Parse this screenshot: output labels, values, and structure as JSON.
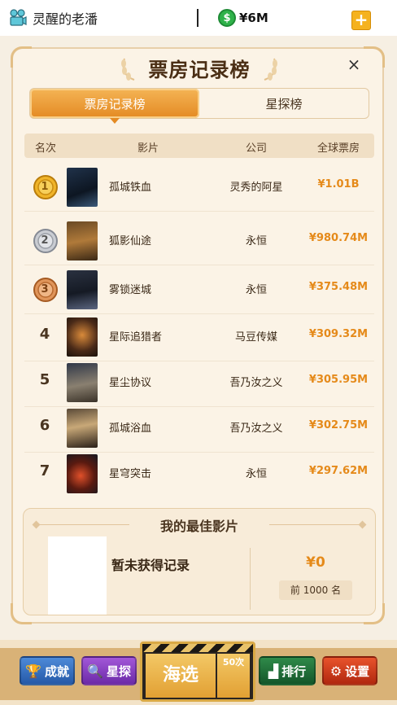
{
  "topbar": {
    "studio_name": "灵醒的老潘",
    "money": "¥6M",
    "coin_symbol": "$",
    "plus_label": "+"
  },
  "panel": {
    "title": "票房记录榜",
    "close_label": "×",
    "tabs": [
      {
        "label": "票房记录榜",
        "active": true
      },
      {
        "label": "星探榜",
        "active": false
      }
    ],
    "columns": [
      "名次",
      "影片",
      "公司",
      "全球票房"
    ],
    "rows": [
      {
        "rank": "1",
        "movie": "孤城铁血",
        "company": "灵秀的阿星",
        "gross": "¥1.01B",
        "medal": "gold"
      },
      {
        "rank": "2",
        "movie": "狐影仙途",
        "company": "永恒",
        "gross": "¥980.74M",
        "medal": "silver"
      },
      {
        "rank": "3",
        "movie": "雾锁迷城",
        "company": "永恒",
        "gross": "¥375.48M",
        "medal": "bronze"
      },
      {
        "rank": "4",
        "movie": "星际追猎者",
        "company": "马豆传媒",
        "gross": "¥309.32M"
      },
      {
        "rank": "5",
        "movie": "星尘协议",
        "company": "吾乃汝之义",
        "gross": "¥305.95M"
      },
      {
        "rank": "6",
        "movie": "孤城浴血",
        "company": "吾乃汝之义",
        "gross": "¥302.75M"
      },
      {
        "rank": "7",
        "movie": "星穹突击",
        "company": "永恒",
        "gross": "¥297.62M"
      }
    ],
    "best": {
      "title": "我的最佳影片",
      "no_record": "暂未获得记录",
      "money": "¥0",
      "rank_label": "前 1000 名"
    }
  },
  "bottom": {
    "achievement": "成就",
    "scout_star": "星探",
    "scout_main": "海选",
    "scout_count": "50次",
    "ranking": "排行",
    "settings": "设置"
  },
  "colors": {
    "accent_orange": "#e58a1a",
    "tab_active": "#e48a23",
    "panel_bg": "#fbf3e6"
  }
}
